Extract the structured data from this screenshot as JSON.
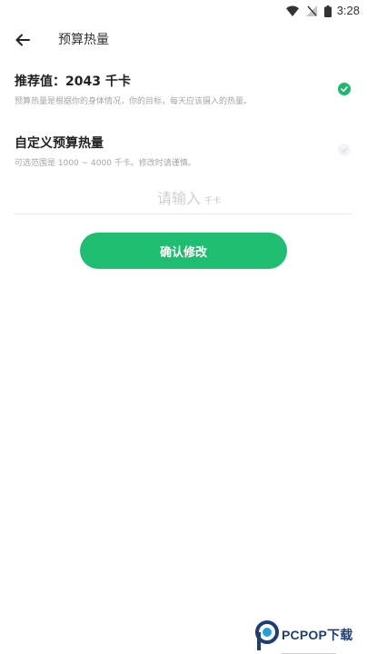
{
  "status_bar": {
    "time": "3:28",
    "icons": [
      "wifi-icon",
      "no-signal-icon",
      "battery-icon"
    ]
  },
  "header": {
    "back_icon": "back-arrow-icon",
    "title": "预算热量"
  },
  "options": {
    "recommended": {
      "title": "推荐值：2043 千卡",
      "description": "预算热量是根据你的身体情况，你的目标，每天应该摄入的热量。",
      "selected": true
    },
    "custom": {
      "title": "自定义预算热量",
      "description": "可选范围是 1000 ~ 4000 千卡。修改时请谨慎。",
      "selected": false
    }
  },
  "calorie_input": {
    "placeholder": "请输入",
    "value": "",
    "unit": "千卡"
  },
  "confirm_button": {
    "label": "确认修改"
  },
  "watermark": {
    "text": "PCPOP下载"
  },
  "colors": {
    "accent": "#1fbd70",
    "check_on": "#1cb86b",
    "check_off": "#f2f4f7",
    "text_primary": "#222222",
    "text_secondary": "#a6a6a6",
    "watermark": "#1d3f77",
    "watermark_accent": "#22a0dc"
  }
}
